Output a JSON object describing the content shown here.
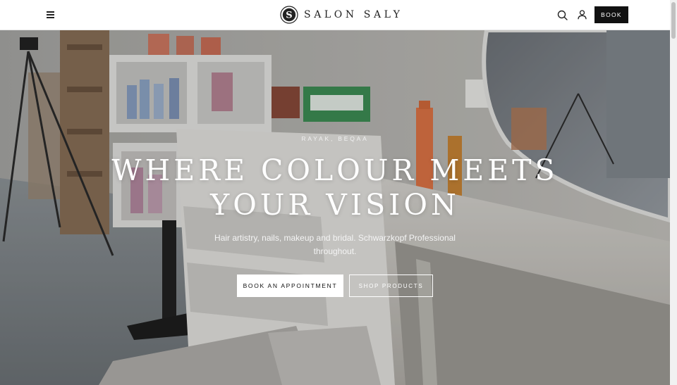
{
  "header": {
    "brand_name": "SALON SALY",
    "brand_monogram": "S",
    "book_label": "BOOK",
    "icons": {
      "menu": "menu-icon",
      "search": "search-icon",
      "account": "user-icon"
    }
  },
  "hero": {
    "location": "RAYAK, BEQAA",
    "headline_line1": "WHERE COLOUR MEETS",
    "headline_line2": "YOUR VISION",
    "subtext": "Hair artistry, nails, makeup and bridal. Schwarzkopf Professional throughout.",
    "primary_cta": "BOOK AN APPOINTMENT",
    "secondary_cta": "SHOP PRODUCTS"
  },
  "colors": {
    "header_bg": "#ffffff",
    "book_button_bg": "#111111",
    "hero_text": "#ffffff",
    "primary_cta_bg": "#ffffff"
  }
}
